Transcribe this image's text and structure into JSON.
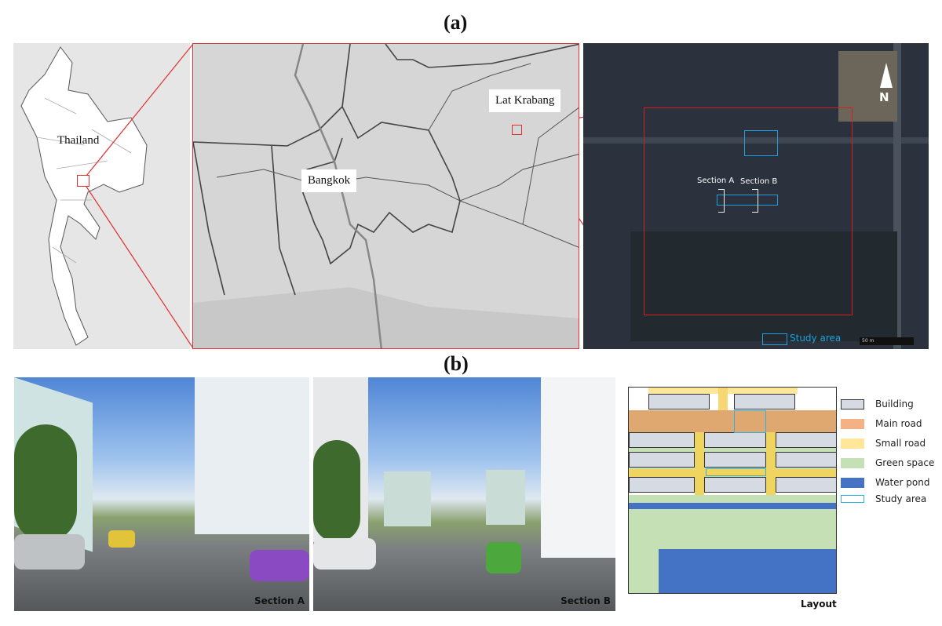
{
  "figure": {
    "panel_a_label": "(a)",
    "panel_b_label": "(b)"
  },
  "maps": {
    "country_label": "Thailand",
    "city_label": "Bangkok",
    "district_label": "Lat Krabang",
    "satellite": {
      "section_a_label": "Section A",
      "section_b_label": "Section B",
      "north_label": "N",
      "study_area_legend": "Study area",
      "scale_label": "50 m"
    }
  },
  "photos": [
    {
      "caption": "Section A"
    },
    {
      "caption": "Section B"
    }
  ],
  "layout": {
    "caption": "Layout",
    "legend": [
      {
        "label": "Building",
        "color": "#d5dae3"
      },
      {
        "label": "Main road",
        "color": "#f4b183"
      },
      {
        "label": "Small road",
        "color": "#ffe699"
      },
      {
        "label": "Green space",
        "color": "#c5e0b4"
      },
      {
        "label": "Water pond",
        "color": "#4472c4"
      },
      {
        "label": "Study area",
        "color": "#2bb3e6"
      }
    ]
  },
  "colors": {
    "highlight_red": "#e03030",
    "study_area_blue": "#1ea0dc"
  }
}
